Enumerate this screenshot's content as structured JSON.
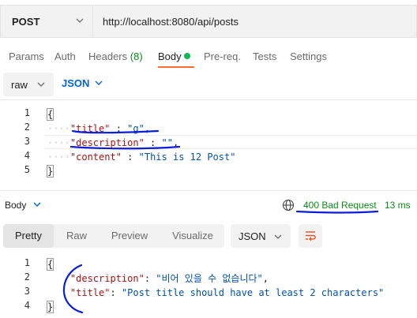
{
  "request": {
    "method": "POST",
    "url": "http://localhost:8080/api/posts"
  },
  "req_tabs": {
    "params": "Params",
    "auth": "Auth",
    "headers": "Headers",
    "headers_count": "(8)",
    "body": "Body",
    "prereq": "Pre-req.",
    "tests": "Tests",
    "settings": "Settings"
  },
  "body_type": {
    "mode": "raw",
    "language": "JSON"
  },
  "request_body": {
    "line_numbers": [
      "1",
      "2",
      "3",
      "4",
      "5"
    ],
    "open_brace": "{",
    "close_brace": "}",
    "lines": [
      {
        "key": "\"title\"",
        "sep": " : ",
        "value": "\"g\"",
        "trail": ","
      },
      {
        "key": "\"description\"",
        "sep": " : ",
        "value": "\"\"",
        "trail": ","
      },
      {
        "key": "\"content\"",
        "sep": " : ",
        "value": "\"This is 12 Post\"",
        "trail": ""
      }
    ]
  },
  "response": {
    "label": "Body",
    "status": "400 Bad Request",
    "time": "13 ms",
    "tabs": [
      "Pretty",
      "Raw",
      "Preview",
      "Visualize"
    ],
    "format": "JSON",
    "line_numbers": [
      "1",
      "2",
      "3",
      "4"
    ],
    "open_brace": "{",
    "close_brace": "}",
    "lines": [
      {
        "key": "\"description\"",
        "sep": ": ",
        "value": "\"비어 있을 수 없습니다\"",
        "trail": ","
      },
      {
        "key": "\"title\"",
        "sep": ": ",
        "value": "\"Post title should have at least 2 characters\"",
        "trail": ""
      }
    ]
  },
  "colors": {
    "accent": "#ff6c37",
    "status_ok": "#0d8c1a",
    "json_key": "#a31515",
    "json_string": "#0451a5",
    "annotation": "#0a1fd6",
    "link_blue": "#0265d2"
  },
  "icons": [
    "chevron-down-icon",
    "dot-indicator-icon",
    "globe-icon",
    "wrap-lines-icon"
  ]
}
